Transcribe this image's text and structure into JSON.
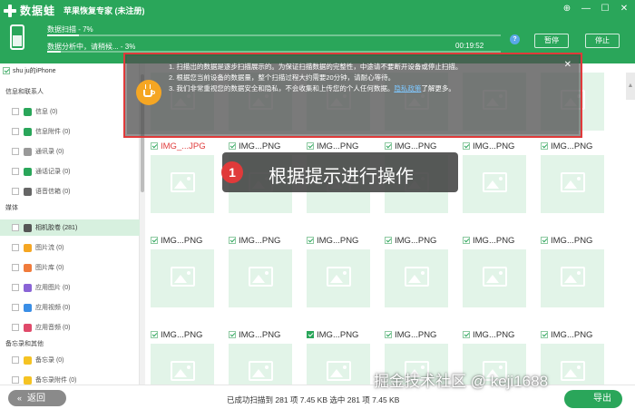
{
  "app": {
    "name": "数据蛙",
    "title": "苹果恢复专家 (未注册)",
    "window_controls": [
      "⊕",
      "—",
      "☐",
      "✕"
    ]
  },
  "progress": {
    "scan_label": "数据扫描 - 7%",
    "scan_percent": 7,
    "analysis_label": "数据分析中，请稍候... - 3%",
    "analysis_percent": 3,
    "elapsed": "00:19:52",
    "help": "?",
    "pause_label": "暂停",
    "stop_label": "停止"
  },
  "sidebar": {
    "device": "shu ju的iPhone",
    "group1": "信息和联系人",
    "group1_items": [
      {
        "label": "信息 (0)",
        "color": "#2aa65a"
      },
      {
        "label": "信息附件 (0)",
        "color": "#2aa65a"
      },
      {
        "label": "通讯录 (0)",
        "color": "#999999"
      },
      {
        "label": "通话记录 (0)",
        "color": "#2aa65a"
      },
      {
        "label": "语音信箱 (0)",
        "color": "#666666"
      }
    ],
    "group2": "媒体",
    "group2_items": [
      {
        "label": "相机胶卷 (281)",
        "color": "#555555",
        "active": true
      },
      {
        "label": "图片流 (0)",
        "color": "#f5a623"
      },
      {
        "label": "图片库 (0)",
        "color": "#f07b3b"
      },
      {
        "label": "应用图片 (0)",
        "color": "#8a64d6"
      },
      {
        "label": "应用视频 (0)",
        "color": "#3a8ee6"
      },
      {
        "label": "应用音频 (0)",
        "color": "#e04a6a"
      }
    ],
    "group3": "备忘录和其他",
    "group3_items": [
      {
        "label": "备忘录 (0)",
        "color": "#f5c323"
      },
      {
        "label": "备忘录附件 (0)",
        "color": "#f5c323"
      }
    ]
  },
  "tip": {
    "line1": "1. 扫描出的数据是逐步扫描展示的。为保证扫描数据的完整性，中途请不要断开设备或停止扫描。",
    "line2": "2. 根据您当前设备的数据量，整个扫描过程大约需要20分钟，请耐心等待。",
    "line3_prefix": "3. 我们非常重视您的数据安全和隐私，不会收集和上传您的个人任何数据。",
    "line3_link": "隐私政策",
    "line3_suffix": "了解更多。",
    "close": "✕"
  },
  "callout": {
    "number": "1",
    "text": "根据提示进行操作"
  },
  "grid": {
    "rows": [
      [
        {
          "name": "IMG_...JPG",
          "red": true
        },
        {
          "name": "IMG...PNG"
        },
        {
          "name": "IMG...PNG"
        },
        {
          "name": "IMG...PNG"
        },
        {
          "name": "IMG...PNG"
        },
        {
          "name": "IMG...PNG"
        }
      ],
      [
        {
          "name": "IMG...PNG"
        },
        {
          "name": "IMG...PNG"
        },
        {
          "name": "IMG...PNG"
        },
        {
          "name": "IMG...PNG"
        },
        {
          "name": "IMG...PNG"
        },
        {
          "name": "IMG...PNG"
        }
      ],
      [
        {
          "name": "IMG...PNG"
        },
        {
          "name": "IMG...PNG"
        },
        {
          "name": "IMG...PNG",
          "filled": true
        },
        {
          "name": "IMG...PNG"
        },
        {
          "name": "IMG...PNG"
        },
        {
          "name": "IMG...PNG"
        }
      ]
    ]
  },
  "bottom": {
    "back_label": "返回",
    "status": "已成功扫描到 281 项 7.45 KB  选中 281 项 7.45 KB",
    "export_label": "导出",
    "watermark": "掘金技术社区 @ keji1688"
  }
}
